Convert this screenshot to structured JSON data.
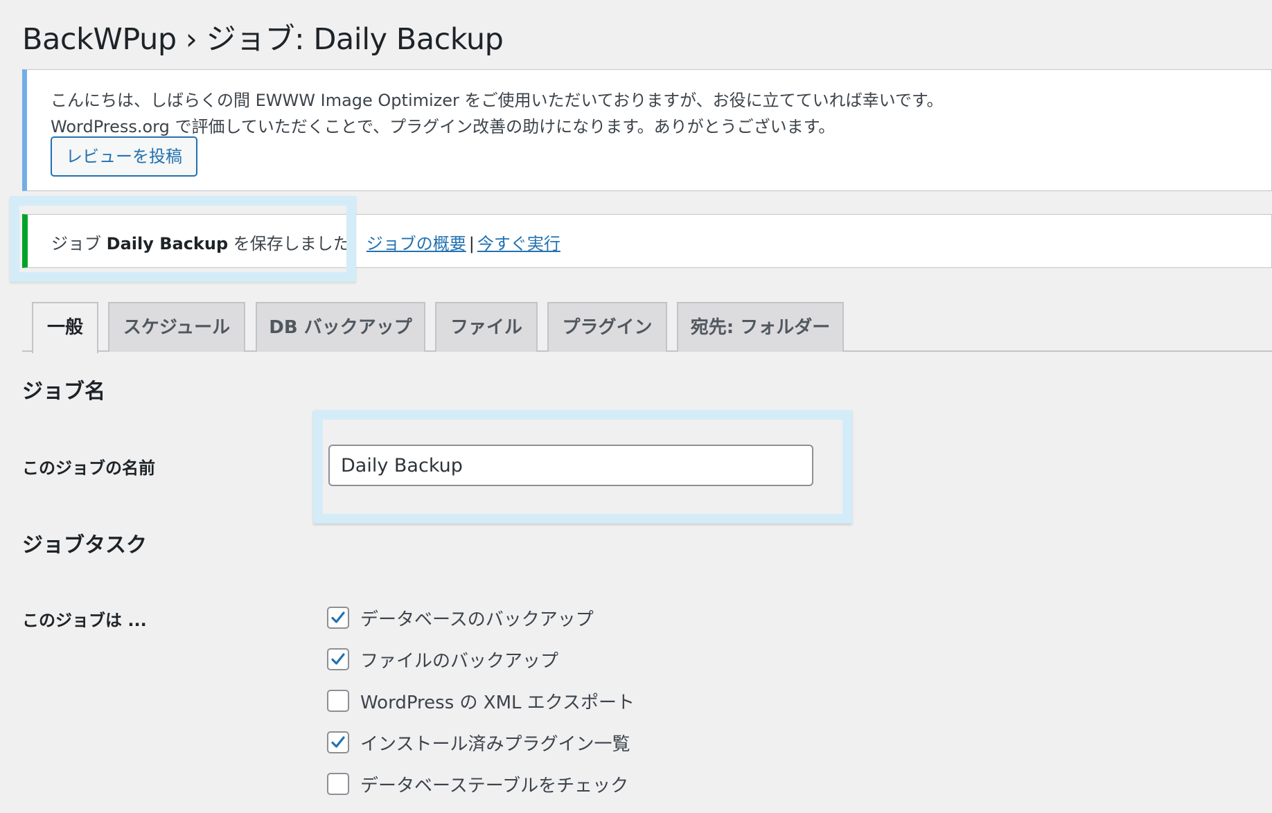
{
  "page": {
    "title": "BackWPup › ジョブ: Daily Backup"
  },
  "review_notice": {
    "line1": "こんにちは、しばらくの間 EWWW Image Optimizer をご使用いただいておりますが、お役に立てていれば幸いです。",
    "line2": "WordPress.org で評価していただくことで、プラグイン改善の助けになります。ありがとうございます。",
    "button_label": "レビューを投稿",
    "accent_color": "#72aee6"
  },
  "saved_notice": {
    "prefix": "ジョブ",
    "job_name": "Daily Backup",
    "suffix": "を保存しました。",
    "link_overview": "ジョブの概要",
    "separator": "|",
    "link_run_now": "今すぐ実行",
    "accent_color": "#00a32a"
  },
  "tabs": [
    {
      "label": "一般",
      "active": true
    },
    {
      "label": "スケジュール",
      "active": false
    },
    {
      "label": "DB バックアップ",
      "active": false
    },
    {
      "label": "ファイル",
      "active": false
    },
    {
      "label": "プラグイン",
      "active": false
    },
    {
      "label": "宛先: フォルダー",
      "active": false
    }
  ],
  "job_name_section": {
    "title": "ジョブ名",
    "field_label": "このジョブの名前",
    "field_value": "Daily Backup"
  },
  "job_tasks_section": {
    "title": "ジョブタスク",
    "field_label": "このジョブは ...",
    "tasks": [
      {
        "label": "データベースのバックアップ",
        "checked": true
      },
      {
        "label": "ファイルのバックアップ",
        "checked": true
      },
      {
        "label": "WordPress の XML エクスポート",
        "checked": false
      },
      {
        "label": "インストール済みプラグイン一覧",
        "checked": true
      },
      {
        "label": "データベーステーブルをチェック",
        "checked": false
      }
    ]
  },
  "colors": {
    "link": "#2271b1",
    "highlight": "#d4ecf7",
    "background": "#f0f0f1"
  }
}
